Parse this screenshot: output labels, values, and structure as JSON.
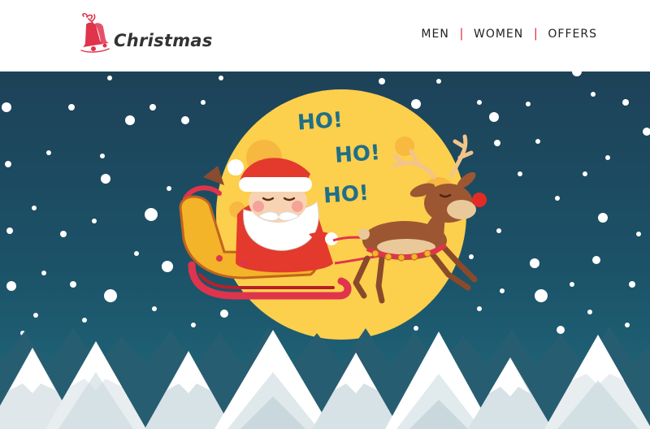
{
  "brand": {
    "name": "Christmas",
    "icon": "bell-icon",
    "accent_color": "#e0344c"
  },
  "nav": {
    "items": [
      {
        "label": "MEN"
      },
      {
        "label": "WOMEN"
      },
      {
        "label": "OFFERS"
      }
    ],
    "separator": "|"
  },
  "hero": {
    "shout_1": "HO!",
    "shout_2": "HO!",
    "shout_3": "HO!",
    "sky_color": "#1d4a5e",
    "moon_color": "#fccf4d"
  }
}
